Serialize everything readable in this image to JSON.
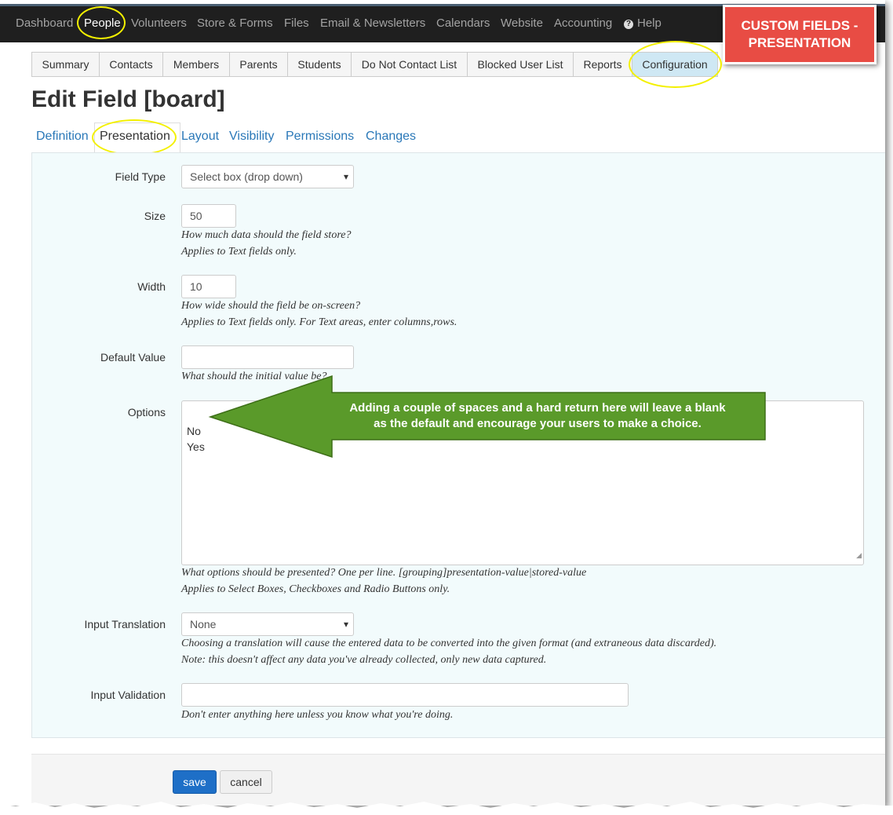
{
  "topnav": {
    "items": [
      "Dashboard",
      "People",
      "Volunteers",
      "Store & Forms",
      "Files",
      "Email & Newsletters",
      "Calendars",
      "Website",
      "Accounting",
      "Help"
    ],
    "active": "People"
  },
  "callout": {
    "line1": "CUSTOM FIELDS -",
    "line2": "PRESENTATION"
  },
  "subtabs": [
    "Summary",
    "Contacts",
    "Members",
    "Parents",
    "Students",
    "Do Not Contact List",
    "Blocked User List",
    "Reports",
    "Configuration"
  ],
  "page_title": "Edit Field [board]",
  "page_tabs": [
    "Definition",
    "Presentation",
    "Layout",
    "Visibility",
    "Permissions",
    "Changes"
  ],
  "form": {
    "field_type": {
      "label": "Field Type",
      "value": "Select box (drop down)"
    },
    "size": {
      "label": "Size",
      "value": "50",
      "help1": "How much data should the field store?",
      "help2": "Applies to Text fields only."
    },
    "width": {
      "label": "Width",
      "value": "10",
      "help1": "How wide should the field be on-screen?",
      "help2": "Applies to Text fields only. For Text areas, enter columns,rows."
    },
    "default_value": {
      "label": "Default Value",
      "value": "",
      "help1": "What should the initial value be?"
    },
    "options": {
      "label": "Options",
      "lines": [
        "",
        "No",
        "Yes"
      ],
      "help1": "What options should be presented? One per line. [grouping]presentation-value|stored-value",
      "help2": "Applies to Select Boxes, Checkboxes and Radio Buttons only."
    },
    "input_translation": {
      "label": "Input Translation",
      "value": "None",
      "help1": "Choosing a translation will cause the entered data to be converted into the given format (and extraneous data discarded).",
      "help2": "Note: this doesn't affect any data you've already collected, only new data captured."
    },
    "input_validation": {
      "label": "Input Validation",
      "value": "",
      "help1": "Don't enter anything here unless you know what you're doing."
    }
  },
  "buttons": {
    "save": "save",
    "cancel": "cancel"
  },
  "annotation": {
    "line1": "Adding a couple of spaces and a hard return here will leave a blank",
    "line2": "as the default and encourage your users to make a choice."
  },
  "colors": {
    "nav_bg": "#1f1f1f",
    "callout_red": "#e84c44",
    "arrow_green": "#5a9a2a",
    "highlight_ring": "#f3f000",
    "link_blue": "#2a78b8",
    "save_blue": "#1e6fc7"
  }
}
